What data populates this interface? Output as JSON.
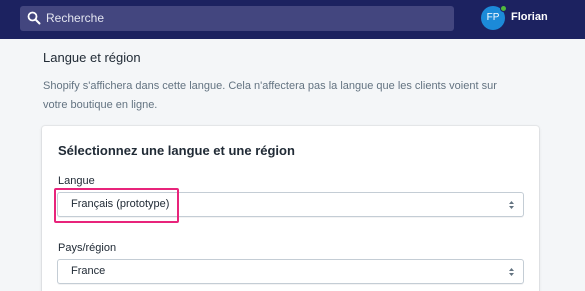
{
  "topbar": {
    "search_placeholder": "Recherche",
    "avatar_initials": "FP",
    "username": "Florian"
  },
  "settings": {
    "title": "Langue et région",
    "description": "Shopify s'affichera dans cette langue. Cela n'affectera pas la langue que les clients voient sur votre boutique en ligne.",
    "card": {
      "title": "Sélectionnez une langue et une région",
      "language": {
        "label": "Langue",
        "value": "Français (prototype)"
      },
      "region": {
        "label": "Pays/région",
        "value": "France"
      }
    }
  },
  "colors": {
    "topbar": "#1c2260",
    "search": "#43467f",
    "avatar": "#1c8ad8",
    "highlight": "#e8247b"
  }
}
